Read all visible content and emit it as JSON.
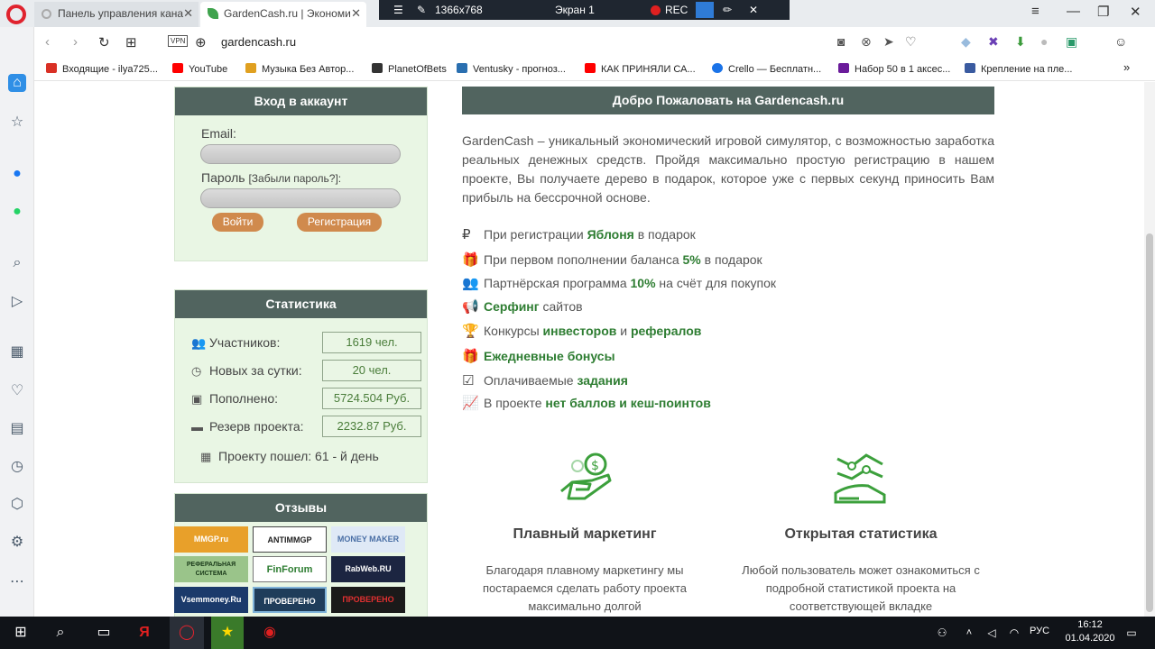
{
  "browser": {
    "tabs": [
      {
        "title": "Панель управления кана"
      },
      {
        "title": "GardenCash.ru | Экономи"
      }
    ],
    "recorder": {
      "resolution": "1366x768",
      "screen": "Экран 1",
      "rec": "REC"
    },
    "address": {
      "vpn": "VPN",
      "url": "gardencash.ru"
    },
    "bookmarks": [
      {
        "label": "Входящие - ilya725...",
        "color": "#d93025"
      },
      {
        "label": "YouTube",
        "color": "#ff0000"
      },
      {
        "label": "Музыка Без Автор...",
        "color": "#e0a020"
      },
      {
        "label": "PlanetOfBets",
        "color": "#333333"
      },
      {
        "label": "Ventusky - прогноз...",
        "color": "#2a6fb0"
      },
      {
        "label": "КАК ПРИНЯЛИ СА...",
        "color": "#ff0000"
      },
      {
        "label": "Crello — Бесплатн...",
        "color": "#1a73e8"
      },
      {
        "label": "Набор 50 в 1 аксес...",
        "color": "#6a1b9a"
      },
      {
        "label": "Крепление на пле...",
        "color": "#3a5ba0"
      }
    ]
  },
  "login": {
    "title": "Вход в аккаунт",
    "email_label": "Email:",
    "password_label": "Пароль",
    "forgot": "[Забыли пароль?]:",
    "login_btn": "Войти",
    "register_btn": "Регистрация"
  },
  "stats": {
    "title": "Статистика",
    "rows": [
      {
        "label": "Участников:",
        "value": "1619 чел.",
        "icon": "users-icon"
      },
      {
        "label": "Новых за сутки:",
        "value": "20 чел.",
        "icon": "clock-icon"
      },
      {
        "label": "Пополнено:",
        "value": "5724.504 Руб.",
        "icon": "money-icon"
      },
      {
        "label": "Резерв проекта:",
        "value": "2232.87 Руб.",
        "icon": "card-icon"
      }
    ],
    "days": "Проекту пошел: 61 - й день"
  },
  "reviews": {
    "title": "Отзывы",
    "logos": [
      {
        "text": "MMGP.ru",
        "color": "#e8a02a"
      },
      {
        "text": "ANTIMMGP",
        "color": "#ffffff"
      },
      {
        "text": "MONEY MAKER",
        "color": "#dfe9f6"
      },
      {
        "text": "РЕФЕРАЛЬНАЯ СИСТЕМА",
        "color": "#9ac48a"
      },
      {
        "text": "FinForum",
        "color": "#ffffff"
      },
      {
        "text": "RabWeb.RU",
        "color": "#1c2541"
      },
      {
        "text": "Vsemmoney.Ru",
        "color": "#1b3a6b"
      },
      {
        "text": "ПРОВЕРЕНО",
        "color": "#1f3d5a"
      },
      {
        "text": "ПРОВЕРЕНО",
        "color": "#1a1a1a"
      }
    ]
  },
  "welcome": {
    "title": "Добро Пожаловать на Gardencash.ru",
    "intro": "GardenCash – уникальный экономический игровой симулятор, с возможностью заработка реальных денежных средств. Пройдя максимально простую регистрацию в нашем проекте, Вы получаете дерево в подарок, которое уже с первых секунд приносить Вам прибыль на бессрочной основе."
  },
  "features": [
    {
      "icon": "ruble-icon",
      "glyph": "₽",
      "pre": "При регистрации ",
      "bold": "Яблоня",
      "post": " в подарок"
    },
    {
      "icon": "gift-icon",
      "glyph": "🎁",
      "pre": "При первом пополнении баланса ",
      "bold": "5%",
      "post": " в подарок"
    },
    {
      "icon": "users-icon",
      "glyph": "👥",
      "pre": "Партнёрская программа ",
      "bold": "10%",
      "post": " на счёт для покупок"
    },
    {
      "icon": "megaphone-icon",
      "glyph": "📢",
      "pre": "",
      "bold": "Серфинг",
      "post": " сайтов"
    },
    {
      "icon": "trophy-icon",
      "glyph": "🏆",
      "pre": "Конкурсы ",
      "bold": "инвесторов",
      "mid": " и ",
      "bold2": "рефералов",
      "post": ""
    },
    {
      "icon": "gift-icon",
      "glyph": "🎁",
      "pre": "",
      "bold": "Ежедневные бонусы",
      "post": ""
    },
    {
      "icon": "calendar-check-icon",
      "glyph": "☑",
      "pre": "Оплачиваемые ",
      "bold": "задания",
      "post": ""
    },
    {
      "icon": "chart-line-icon",
      "glyph": "📈",
      "pre": "В проекте ",
      "bold": "нет баллов и кеш-поинтов",
      "post": ""
    }
  ],
  "columns": [
    {
      "title": "Плавный маркетинг",
      "text": "Благодаря плавному маркетингу мы постараемся сделать работу проекта максимально долгой"
    },
    {
      "title": "Открытая статистика",
      "text": "Любой пользователь может ознакомиться с подробной статистикой проекта на соответствующей вкладке"
    }
  ],
  "taskbar": {
    "lang": "РУС",
    "time": "16:12",
    "date": "01.04.2020"
  }
}
